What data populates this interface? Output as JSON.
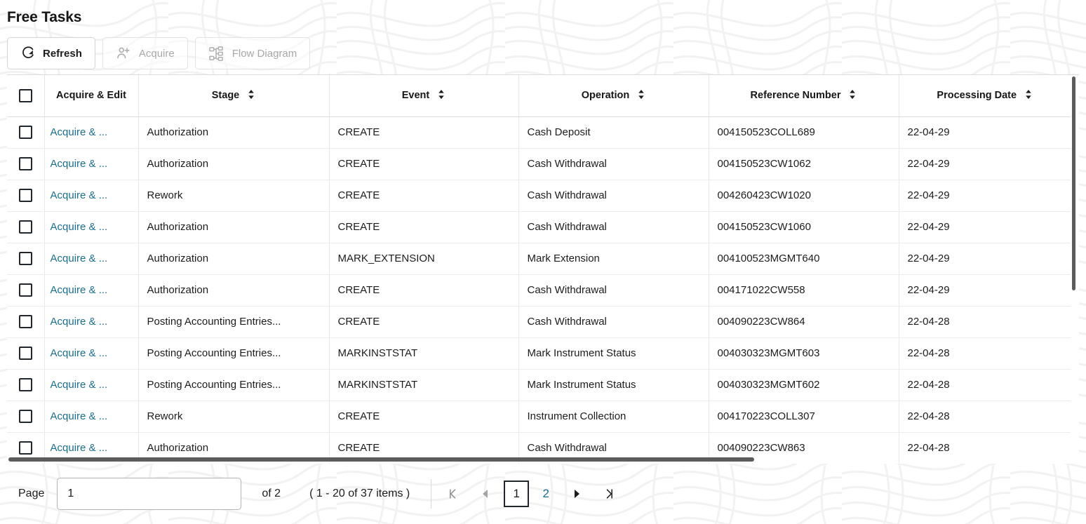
{
  "header": {
    "title": "Free Tasks"
  },
  "toolbar": {
    "buttons": [
      {
        "label": "Refresh",
        "icon": "refresh-icon",
        "disabled": false
      },
      {
        "label": "Acquire",
        "icon": "person-add-icon",
        "disabled": true
      },
      {
        "label": "Flow Diagram",
        "icon": "flow-diagram-icon",
        "disabled": true
      }
    ]
  },
  "table": {
    "select_all_checkbox": false,
    "columns": [
      {
        "key": "checkbox",
        "label": "",
        "sortable": false
      },
      {
        "key": "acquire_edit",
        "label": "Acquire & Edit",
        "sortable": false
      },
      {
        "key": "stage",
        "label": "Stage",
        "sortable": true
      },
      {
        "key": "event",
        "label": "Event",
        "sortable": true
      },
      {
        "key": "operation",
        "label": "Operation",
        "sortable": true
      },
      {
        "key": "reference_number",
        "label": "Reference Number",
        "sortable": true
      },
      {
        "key": "processing_date",
        "label": "Processing Date",
        "sortable": true
      }
    ],
    "action_label": "Acquire & ...",
    "rows": [
      {
        "stage": "Authorization",
        "event": "CREATE",
        "operation": "Cash Deposit",
        "reference_number": "004150523COLL689",
        "processing_date": "22-04-29"
      },
      {
        "stage": "Authorization",
        "event": "CREATE",
        "operation": "Cash Withdrawal",
        "reference_number": "004150523CW1062",
        "processing_date": "22-04-29"
      },
      {
        "stage": "Rework",
        "event": "CREATE",
        "operation": "Cash Withdrawal",
        "reference_number": "004260423CW1020",
        "processing_date": "22-04-29"
      },
      {
        "stage": "Authorization",
        "event": "CREATE",
        "operation": "Cash Withdrawal",
        "reference_number": "004150523CW1060",
        "processing_date": "22-04-29"
      },
      {
        "stage": "Authorization",
        "event": "MARK_EXTENSION",
        "operation": "Mark Extension",
        "reference_number": "004100523MGMT640",
        "processing_date": "22-04-29"
      },
      {
        "stage": "Authorization",
        "event": "CREATE",
        "operation": "Cash Withdrawal",
        "reference_number": "004171022CW558",
        "processing_date": "22-04-29"
      },
      {
        "stage": "Posting Accounting Entries...",
        "event": "CREATE",
        "operation": "Cash Withdrawal",
        "reference_number": "004090223CW864",
        "processing_date": "22-04-28"
      },
      {
        "stage": "Posting Accounting Entries...",
        "event": "MARKINSTSTAT",
        "operation": "Mark Instrument Status",
        "reference_number": "004030323MGMT603",
        "processing_date": "22-04-28"
      },
      {
        "stage": "Posting Accounting Entries...",
        "event": "MARKINSTSTAT",
        "operation": "Mark Instrument Status",
        "reference_number": "004030323MGMT602",
        "processing_date": "22-04-28"
      },
      {
        "stage": "Rework",
        "event": "CREATE",
        "operation": "Instrument Collection",
        "reference_number": "004170223COLL307",
        "processing_date": "22-04-28"
      },
      {
        "stage": "Authorization",
        "event": "CREATE",
        "operation": "Cash Withdrawal",
        "reference_number": "004090223CW863",
        "processing_date": "22-04-28"
      }
    ]
  },
  "pagination": {
    "page_label": "Page",
    "page_value": "1",
    "of_text": "of 2",
    "items_text": "( 1 - 20 of 37 items )",
    "first_icon": "first-page-icon",
    "prev_icon": "previous-page-icon",
    "next_icon": "next-page-icon",
    "last_icon": "last-page-icon",
    "pages": [
      "1",
      "2"
    ],
    "current_page": "1"
  },
  "colors": {
    "link": "#1a6e8e",
    "text": "#1c1c1c",
    "border": "#dcdcdc",
    "disabled": "#a8a8a8"
  }
}
